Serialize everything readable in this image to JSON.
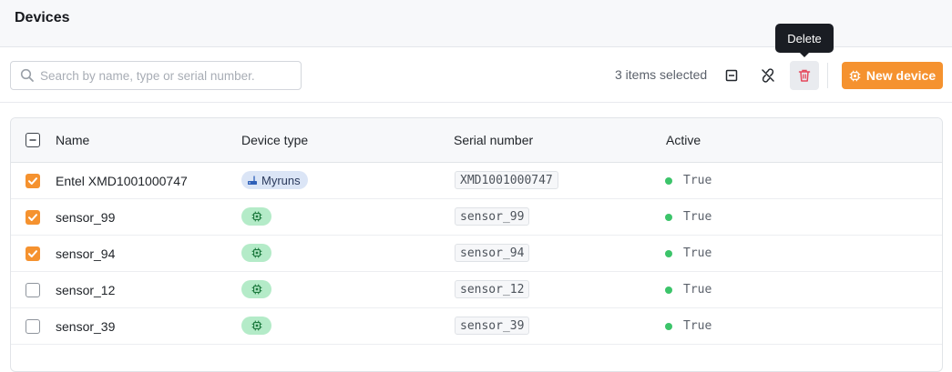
{
  "header": {
    "title": "Devices"
  },
  "toolbar": {
    "search_placeholder": "Search by name, type or serial number.",
    "selected_text": "3 items selected",
    "tooltip": "Delete",
    "new_device_label": "New device",
    "accent_color": "#f5922f",
    "delete_color": "#e5475b"
  },
  "table": {
    "columns": [
      "Name",
      "Device type",
      "Serial number",
      "Active"
    ],
    "header_checkbox": "indeterminate",
    "rows": [
      {
        "checked": true,
        "name": "Entel XMD1001000747",
        "type": "Myruns",
        "type_icon": "router-icon",
        "serial": "XMD1001000747",
        "active": "True"
      },
      {
        "checked": true,
        "name": "sensor_99",
        "type": "",
        "type_icon": "chip-icon",
        "serial": "sensor_99",
        "active": "True"
      },
      {
        "checked": true,
        "name": "sensor_94",
        "type": "",
        "type_icon": "chip-icon",
        "serial": "sensor_94",
        "active": "True"
      },
      {
        "checked": false,
        "name": "sensor_12",
        "type": "",
        "type_icon": "chip-icon",
        "serial": "sensor_12",
        "active": "True"
      },
      {
        "checked": false,
        "name": "sensor_39",
        "type": "",
        "type_icon": "chip-icon",
        "serial": "sensor_39",
        "active": "True"
      }
    ]
  }
}
